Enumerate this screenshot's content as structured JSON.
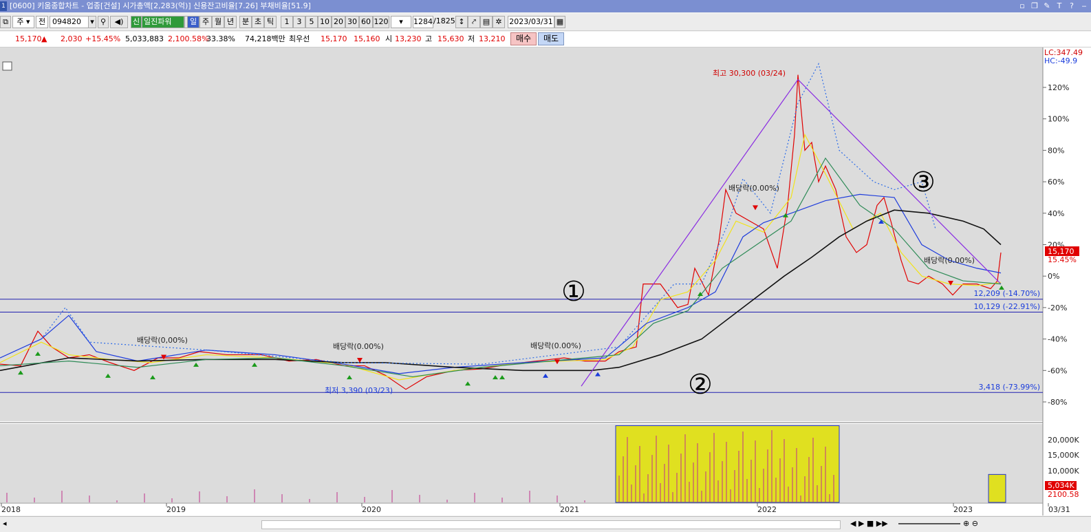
{
  "window": {
    "title": "[0600] 키움종합차트 - 업종[건설] 시가총액[2,283(억)] 신용잔고비율[7.26] 부채비율[51.9]",
    "icon_label": "1"
  },
  "toolbar": {
    "period_main": "주",
    "market_sel": "전",
    "code": "094820",
    "credit_badge": "신",
    "stock_name": "일진파워",
    "periods": [
      "일",
      "주",
      "월",
      "년",
      "분",
      "초",
      "틱"
    ],
    "intervals": [
      "1",
      "3",
      "5",
      "10",
      "20",
      "30",
      "60",
      "120"
    ],
    "count_current": "1284",
    "count_total": "/1825",
    "date": "2023/03/31"
  },
  "quote": {
    "price": "15,170",
    "change_arrow": "▲",
    "change": "2,030",
    "change_pct": "+15.45%",
    "volume": "5,033,883",
    "volume_ratio": "2,100.58%",
    "turnover": "33.38%",
    "amount": "74,218백만",
    "best_ask_label": "최우선",
    "best_ask": "15,170",
    "best_bid": "15,160",
    "open_label": "시",
    "open": "13,230",
    "high_label": "고",
    "high": "15,630",
    "low_label": "저",
    "low": "13,210",
    "buy_label": "매수",
    "sell_label": "매도"
  },
  "chart_labels": {
    "max_label": "최고 30,300 (03/24)",
    "min_label": "최저 3,390 (03/23)",
    "dividend": "배당락(0,00%)",
    "dividend2": "배당락(0.00%)",
    "line1_label": "12,209 (-14.70%)",
    "line2_label": "10,129 (-22.91%)",
    "line3_label": "3,418 (-73.99%)",
    "circle1": "①",
    "circle2": "②",
    "circle3": "③",
    "lc": "LC:347.49",
    "hc": "HC:-49.9",
    "price_box": "15,170",
    "price_pct": "15.45%",
    "vol_box": "5,034K",
    "vol_pct": "2100.58"
  },
  "chart_data": {
    "type": "line",
    "x_labels": [
      "2018",
      "2019",
      "2020",
      "2021",
      "2022",
      "2023",
      "03/31"
    ],
    "y_axis_pct": [
      "120%",
      "100%",
      "80%",
      "60%",
      "40%",
      "20%",
      "0%",
      "-20%",
      "-40%",
      "-60%",
      "-80%"
    ],
    "y_range_pct": [
      -90,
      140
    ],
    "volume_axis": [
      "20,000K",
      "15,000K",
      "10,000K",
      "5,000K"
    ],
    "series": [
      {
        "color": "#e00000",
        "points": [
          [
            0,
            -56
          ],
          [
            30,
            -57
          ],
          [
            55,
            -35
          ],
          [
            75,
            -45
          ],
          [
            100,
            -52
          ],
          [
            130,
            -50
          ],
          [
            160,
            -55
          ],
          [
            195,
            -60
          ],
          [
            230,
            -52
          ],
          [
            260,
            -52
          ],
          [
            290,
            -48
          ],
          [
            330,
            -50
          ],
          [
            380,
            -50
          ],
          [
            420,
            -54
          ],
          [
            460,
            -53
          ],
          [
            500,
            -57
          ],
          [
            530,
            -57
          ],
          [
            560,
            -63
          ],
          [
            590,
            -72
          ],
          [
            620,
            -64
          ],
          [
            660,
            -60
          ],
          [
            700,
            -59
          ],
          [
            740,
            -56
          ],
          [
            780,
            -54
          ],
          [
            820,
            -52
          ],
          [
            850,
            -54
          ],
          [
            880,
            -54
          ],
          [
            900,
            -48
          ],
          [
            925,
            -45
          ],
          [
            935,
            -5
          ],
          [
            960,
            -5
          ],
          [
            985,
            -20
          ],
          [
            1000,
            -18
          ],
          [
            1010,
            5
          ],
          [
            1030,
            -12
          ],
          [
            1045,
            22
          ],
          [
            1055,
            55
          ],
          [
            1070,
            40
          ],
          [
            1090,
            35
          ],
          [
            1110,
            30
          ],
          [
            1130,
            5
          ],
          [
            1145,
            45
          ],
          [
            1155,
            90
          ],
          [
            1160,
            128
          ],
          [
            1170,
            80
          ],
          [
            1180,
            85
          ],
          [
            1190,
            60
          ],
          [
            1200,
            70
          ],
          [
            1215,
            55
          ],
          [
            1230,
            25
          ],
          [
            1245,
            15
          ],
          [
            1260,
            20
          ],
          [
            1275,
            45
          ],
          [
            1285,
            50
          ],
          [
            1295,
            35
          ],
          [
            1310,
            10
          ],
          [
            1320,
            -3
          ],
          [
            1335,
            -5
          ],
          [
            1350,
            0
          ],
          [
            1370,
            -5
          ],
          [
            1385,
            -12
          ],
          [
            1400,
            -5
          ],
          [
            1420,
            -5
          ],
          [
            1440,
            -8
          ],
          [
            1450,
            -3
          ],
          [
            1455,
            15
          ]
        ]
      },
      {
        "color": "#f2e31a",
        "points": [
          [
            0,
            -55
          ],
          [
            60,
            -42
          ],
          [
            100,
            -50
          ],
          [
            160,
            -53
          ],
          [
            220,
            -55
          ],
          [
            300,
            -50
          ],
          [
            400,
            -52
          ],
          [
            500,
            -56
          ],
          [
            580,
            -66
          ],
          [
            660,
            -60
          ],
          [
            760,
            -55
          ],
          [
            880,
            -53
          ],
          [
            920,
            -45
          ],
          [
            960,
            -15
          ],
          [
            1000,
            -10
          ],
          [
            1040,
            10
          ],
          [
            1070,
            35
          ],
          [
            1110,
            28
          ],
          [
            1150,
            50
          ],
          [
            1170,
            90
          ],
          [
            1200,
            65
          ],
          [
            1240,
            30
          ],
          [
            1280,
            40
          ],
          [
            1310,
            15
          ],
          [
            1340,
            0
          ],
          [
            1380,
            -5
          ],
          [
            1420,
            -6
          ],
          [
            1455,
            -4
          ]
        ]
      },
      {
        "color": "#1e3cdc",
        "points": [
          [
            0,
            -52
          ],
          [
            60,
            -40
          ],
          [
            100,
            -25
          ],
          [
            140,
            -48
          ],
          [
            200,
            -54
          ],
          [
            300,
            -47
          ],
          [
            400,
            -50
          ],
          [
            500,
            -56
          ],
          [
            580,
            -62
          ],
          [
            660,
            -58
          ],
          [
            760,
            -55
          ],
          [
            880,
            -52
          ],
          [
            940,
            -30
          ],
          [
            1000,
            -20
          ],
          [
            1040,
            -10
          ],
          [
            1080,
            25
          ],
          [
            1110,
            34
          ],
          [
            1150,
            40
          ],
          [
            1200,
            48
          ],
          [
            1250,
            52
          ],
          [
            1300,
            50
          ],
          [
            1340,
            20
          ],
          [
            1380,
            10
          ],
          [
            1420,
            5
          ],
          [
            1455,
            2
          ]
        ]
      },
      {
        "color": "#111111",
        "points": [
          [
            0,
            -60
          ],
          [
            100,
            -52
          ],
          [
            200,
            -54
          ],
          [
            300,
            -53
          ],
          [
            400,
            -53
          ],
          [
            500,
            -55
          ],
          [
            560,
            -55
          ],
          [
            660,
            -58
          ],
          [
            760,
            -60
          ],
          [
            860,
            -60
          ],
          [
            900,
            -58
          ],
          [
            960,
            -50
          ],
          [
            1020,
            -40
          ],
          [
            1080,
            -20
          ],
          [
            1140,
            0
          ],
          [
            1180,
            12
          ],
          [
            1220,
            25
          ],
          [
            1260,
            35
          ],
          [
            1300,
            42
          ],
          [
            1350,
            40
          ],
          [
            1400,
            35
          ],
          [
            1430,
            30
          ],
          [
            1455,
            20
          ]
        ]
      },
      {
        "color": "#8a2be2",
        "points": [
          [
            845,
            -70
          ],
          [
            1160,
            125
          ]
        ]
      },
      {
        "color": "#8a2be2",
        "points": [
          [
            1160,
            125
          ],
          [
            1455,
            -5
          ]
        ]
      },
      {
        "color": "#2a6ae8",
        "dashed": true,
        "points": [
          [
            60,
            -40
          ],
          [
            95,
            -20
          ],
          [
            130,
            -42
          ],
          [
            300,
            -47
          ],
          [
            500,
            -55
          ],
          [
            700,
            -56
          ],
          [
            900,
            -45
          ],
          [
            980,
            -5
          ],
          [
            1020,
            -5
          ],
          [
            1060,
            35
          ],
          [
            1080,
            62
          ],
          [
            1120,
            40
          ],
          [
            1160,
            110
          ],
          [
            1190,
            135
          ],
          [
            1220,
            80
          ],
          [
            1270,
            60
          ],
          [
            1300,
            55
          ],
          [
            1340,
            60
          ],
          [
            1360,
            30
          ]
        ]
      },
      {
        "color": "#2e8b57",
        "points": [
          [
            0,
            -57
          ],
          [
            100,
            -54
          ],
          [
            200,
            -58
          ],
          [
            300,
            -53
          ],
          [
            400,
            -52
          ],
          [
            500,
            -57
          ],
          [
            600,
            -64
          ],
          [
            700,
            -58
          ],
          [
            800,
            -54
          ],
          [
            900,
            -50
          ],
          [
            950,
            -30
          ],
          [
            1000,
            -22
          ],
          [
            1050,
            5
          ],
          [
            1100,
            20
          ],
          [
            1150,
            35
          ],
          [
            1200,
            75
          ],
          [
            1250,
            45
          ],
          [
            1300,
            30
          ],
          [
            1350,
            5
          ],
          [
            1400,
            -3
          ],
          [
            1455,
            -5
          ]
        ]
      }
    ],
    "horizontal_lines_pct": [
      -14.7,
      -22.91,
      -73.99
    ],
    "volume_bars": [
      {
        "x0": 895,
        "x1": 1220,
        "k": 22500
      },
      {
        "x0": 1437,
        "x1": 1462,
        "k": 8200
      }
    ]
  },
  "status": {
    "controls": "◀ ▶ ■ ▶▶"
  }
}
